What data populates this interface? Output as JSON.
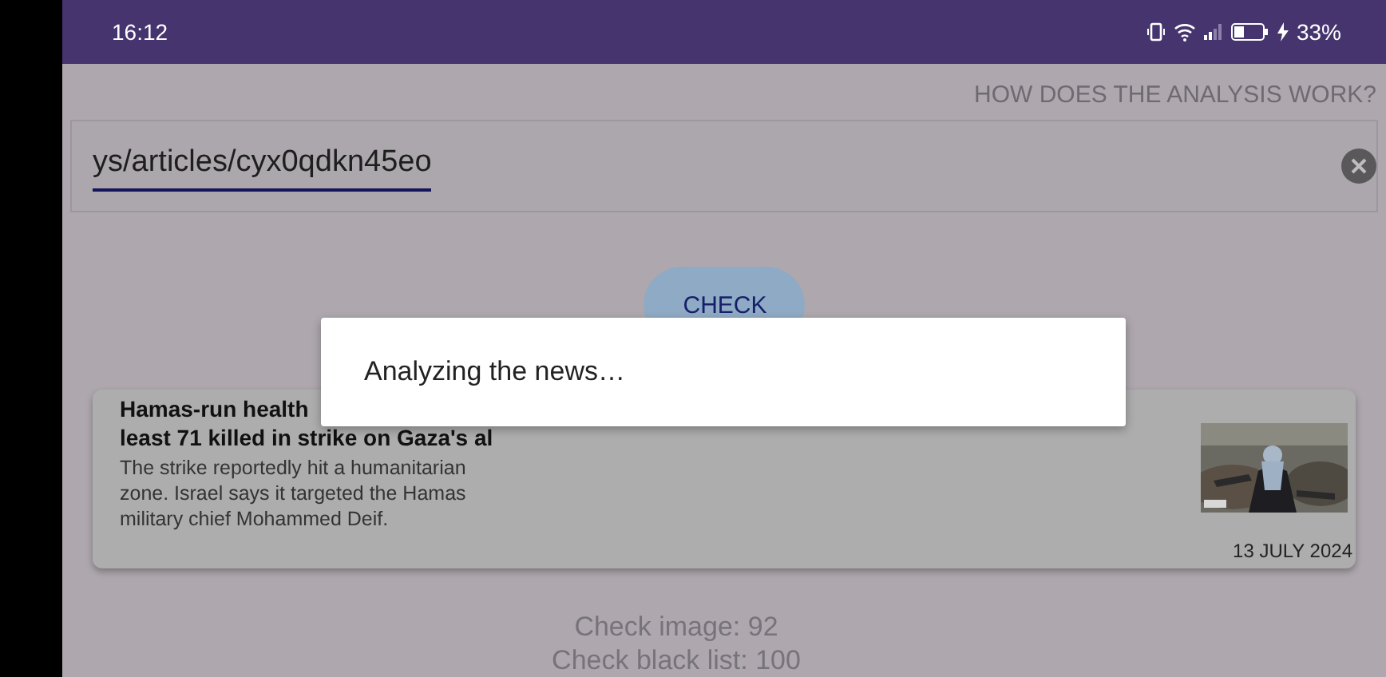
{
  "status_bar": {
    "time": "16:12",
    "battery": "33%"
  },
  "help_link": "HOW DOES THE ANALYSIS WORK?",
  "url_field": {
    "value": "ys/articles/cyx0qdkn45eo"
  },
  "check_button": "CHECK",
  "dialog": {
    "message": "Analyzing the news…"
  },
  "article": {
    "title_lines": [
      "Hamas-run health",
      "least 71 killed in strike on Gaza's al"
    ],
    "summary": "The strike reportedly hit a humanitarian zone. Israel says it targeted the Hamas military chief Mohammed Deif.",
    "date": "13 JULY 2024"
  },
  "results": [
    "Check image: 92",
    "Check black list: 100"
  ]
}
